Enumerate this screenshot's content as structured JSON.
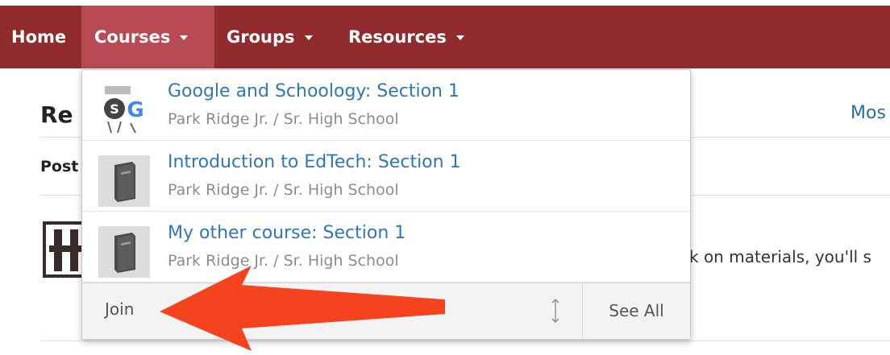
{
  "nav": {
    "items": [
      {
        "label": "Home"
      },
      {
        "label": "Courses"
      },
      {
        "label": "Groups"
      },
      {
        "label": "Resources"
      }
    ]
  },
  "background": {
    "heading": "Re",
    "link": "Mos",
    "tab": "Post",
    "text": "k on materials, you'll s"
  },
  "dropdown": {
    "courses": [
      {
        "title": "Google and Schoology: Section 1",
        "school": "Park Ridge Jr. / Sr. High School",
        "icon": "google-schoology-icon"
      },
      {
        "title": "Introduction to EdTech: Section 1",
        "school": "Park Ridge Jr. / Sr. High School",
        "icon": "book-icon"
      },
      {
        "title": "My other course: Section 1",
        "school": "Park Ridge Jr. / Sr. High School",
        "icon": "book-icon"
      }
    ],
    "join_label": "Join",
    "see_all_label": "See All"
  },
  "colors": {
    "nav_bg": "#922b2e",
    "nav_active": "#b84a54",
    "link": "#2f77b5",
    "annotation_arrow": "#f5421f"
  }
}
